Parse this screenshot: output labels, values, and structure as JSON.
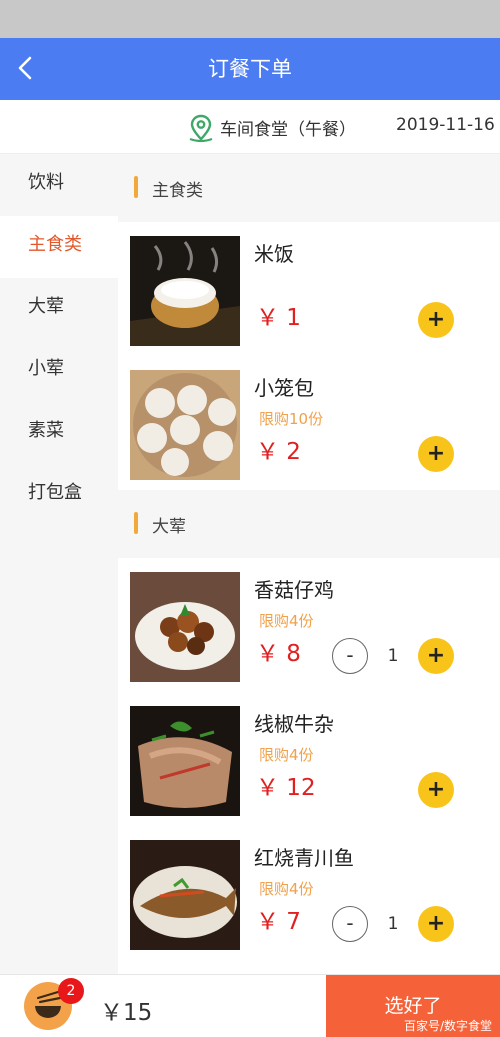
{
  "header": {
    "title": "订餐下单"
  },
  "info": {
    "location": "车间食堂（午餐）",
    "date": "2019-11-16"
  },
  "sidebar": {
    "categories": [
      {
        "label": "饮料",
        "active": false
      },
      {
        "label": "主食类",
        "active": true
      },
      {
        "label": "大荤",
        "active": false
      },
      {
        "label": "小荤",
        "active": false
      },
      {
        "label": "素菜",
        "active": false
      },
      {
        "label": "打包盒",
        "active": false
      }
    ]
  },
  "sections": [
    {
      "title": "主食类",
      "items": [
        {
          "name": "米饭",
          "limit": "",
          "price": "￥ 1",
          "quantity": "",
          "plus": "+",
          "minus": ""
        },
        {
          "name": "小笼包",
          "limit": "限购10份",
          "price": "￥ 2",
          "quantity": "",
          "plus": "+",
          "minus": ""
        }
      ]
    },
    {
      "title": "大荤",
      "items": [
        {
          "name": "香菇仔鸡",
          "limit": "限购4份",
          "price": "￥ 8",
          "quantity": "1",
          "plus": "+",
          "minus": "-"
        },
        {
          "name": "线椒牛杂",
          "limit": "限购4份",
          "price": "￥ 12",
          "quantity": "",
          "plus": "+",
          "minus": ""
        },
        {
          "name": "红烧青川鱼",
          "limit": "限购4份",
          "price": "￥ 7",
          "quantity": "1",
          "plus": "+",
          "minus": "-"
        }
      ]
    }
  ],
  "footer": {
    "cart_count": "2",
    "total": "￥15",
    "submit_label": "选好了"
  },
  "watermark": "百家号/数字食堂",
  "colors": {
    "header": "#4b7cf1",
    "accent": "#e1582c",
    "price": "#e02020",
    "plus": "#f9c41a",
    "submit": "#f5623a"
  }
}
